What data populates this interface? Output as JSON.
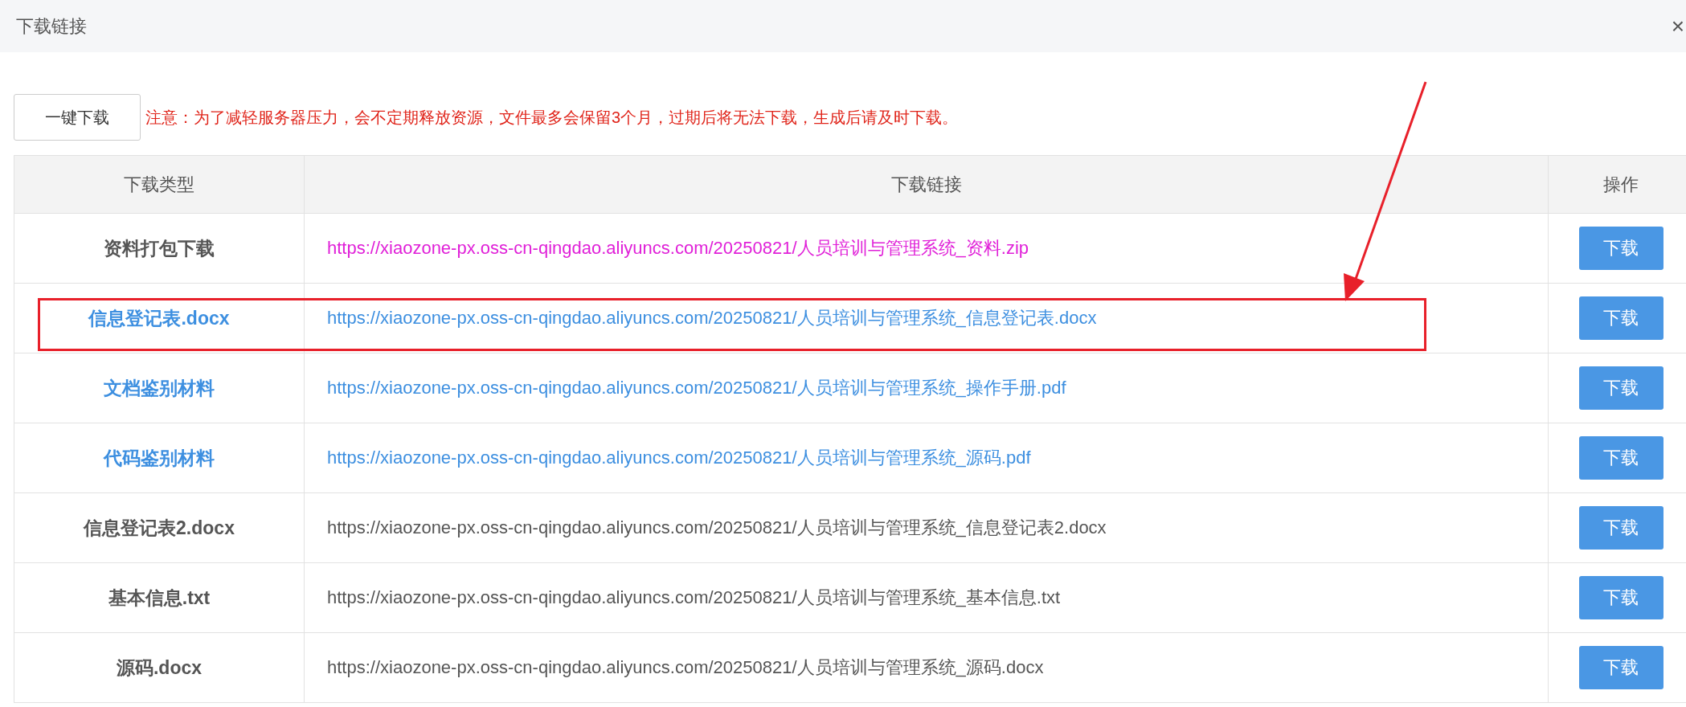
{
  "dialog": {
    "title": "下载链接",
    "close": "×"
  },
  "toolbar": {
    "button": "一键下载",
    "notice": "注意：为了减轻服务器压力，会不定期释放资源，文件最多会保留3个月，过期后将无法下载，生成后请及时下载。"
  },
  "table": {
    "columns": [
      "下载类型",
      "下载链接",
      "操作"
    ],
    "rows": [
      {
        "kind": "bundle",
        "highlighted": false,
        "name": "资料打包下载",
        "link": "https://xiaozone-px.oss-cn-qingdao.aliyuncs.com/20250821/人员培训与管理系统_资料.zip",
        "action": "下载"
      },
      {
        "kind": "featured",
        "highlighted": true,
        "name": "信息登记表.docx",
        "link": "https://xiaozone-px.oss-cn-qingdao.aliyuncs.com/20250821/人员培训与管理系统_信息登记表.docx",
        "action": "下载"
      },
      {
        "kind": "featured",
        "highlighted": false,
        "name": "文档鉴别材料",
        "link": "https://xiaozone-px.oss-cn-qingdao.aliyuncs.com/20250821/人员培训与管理系统_操作手册.pdf",
        "action": "下载"
      },
      {
        "kind": "featured",
        "highlighted": false,
        "name": "代码鉴别材料",
        "link": "https://xiaozone-px.oss-cn-qingdao.aliyuncs.com/20250821/人员培训与管理系统_源码.pdf",
        "action": "下载"
      },
      {
        "kind": "plain",
        "highlighted": false,
        "name": "信息登记表2.docx",
        "link": "https://xiaozone-px.oss-cn-qingdao.aliyuncs.com/20250821/人员培训与管理系统_信息登记表2.docx",
        "action": "下载"
      },
      {
        "kind": "plain",
        "highlighted": false,
        "name": "基本信息.txt",
        "link": "https://xiaozone-px.oss-cn-qingdao.aliyuncs.com/20250821/人员培训与管理系统_基本信息.txt",
        "action": "下载"
      },
      {
        "kind": "plain",
        "highlighted": false,
        "name": "源码.docx",
        "link": "https://xiaozone-px.oss-cn-qingdao.aliyuncs.com/20250821/人员培训与管理系统_源码.docx",
        "action": "下载"
      }
    ]
  }
}
